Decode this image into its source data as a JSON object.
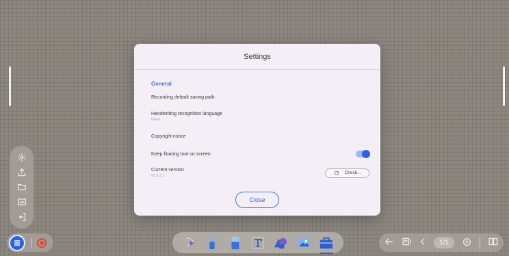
{
  "dialog": {
    "title": "Settings",
    "section_general": "General",
    "recording_label": "Recording default saving path",
    "handwriting_label": "Handwriting recognition language",
    "handwriting_value": "None",
    "copyright_label": "Copyright notice",
    "floating_label": "Keep floating tool on screen",
    "floating_enabled": true,
    "version_label": "Current version",
    "version_value": "v0.3.3.1",
    "check_label": "Check...",
    "close_label": "Close"
  },
  "left_panel": {
    "icons": [
      "settings-icon",
      "share-icon",
      "folder-icon",
      "save-board-icon",
      "exit-icon"
    ]
  },
  "bottom_left": {
    "icons": [
      "menu-icon",
      "record-icon"
    ]
  },
  "toolbar": {
    "icons": [
      "lasso-select-icon",
      "pen-icon",
      "eraser-icon",
      "text-icon",
      "shape-icon",
      "image-icon",
      "toolbox-icon"
    ],
    "active": "toolbox-icon"
  },
  "bottom_right": {
    "page_indicator": "1/1",
    "icons": [
      "undo-icon",
      "page-list-icon",
      "prev-page-icon",
      "add-page-icon",
      "board-layout-icon"
    ]
  },
  "colors": {
    "accent": "#2e62e0",
    "background": "#8b877f",
    "dialog": "#f4eff6"
  }
}
